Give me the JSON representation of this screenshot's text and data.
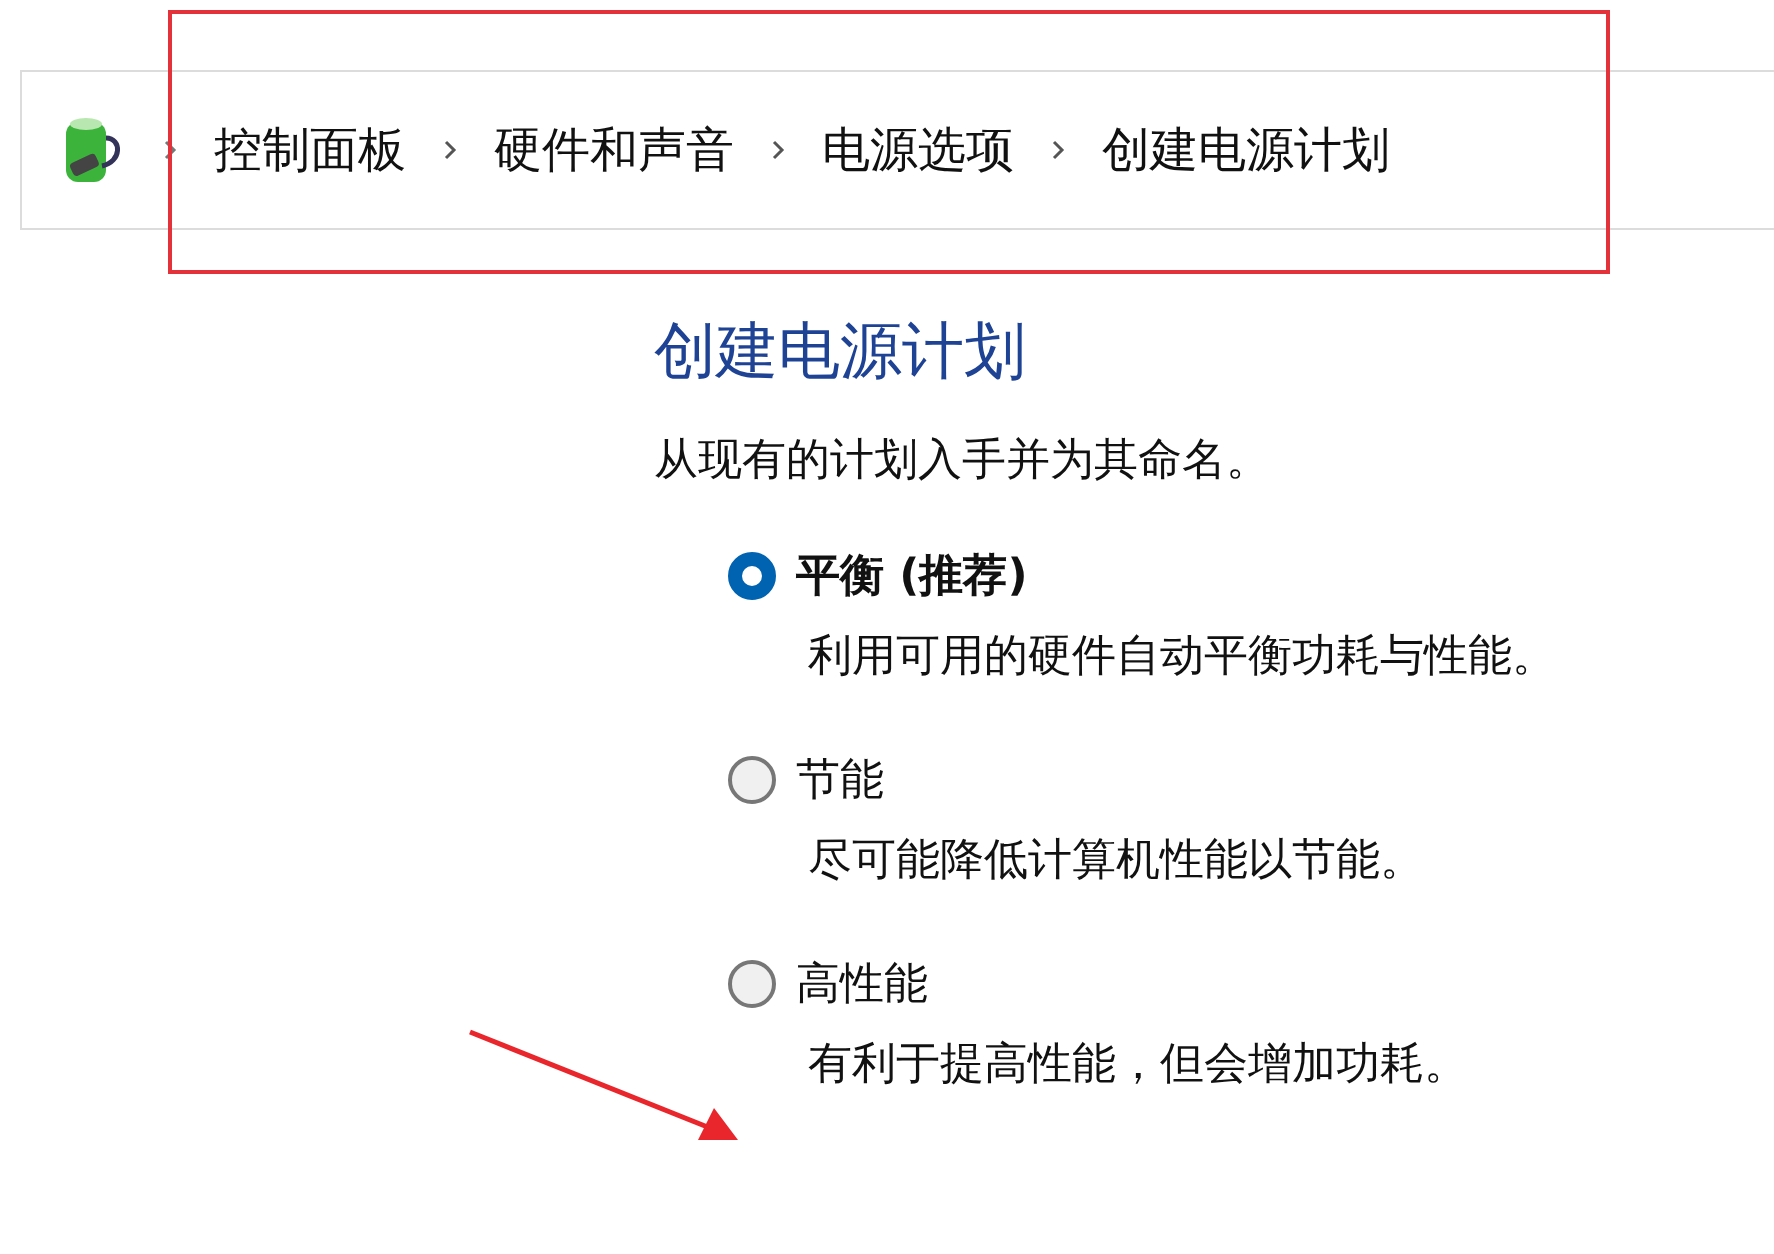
{
  "breadcrumb": [
    "控制面板",
    "硬件和声音",
    "电源选项",
    "创建电源计划"
  ],
  "title": "创建电源计划",
  "subtitle": "从现有的计划入手并为其命名。",
  "plans": [
    {
      "label": "平衡 (推荐)",
      "description": "利用可用的硬件自动平衡功耗与性能。",
      "selected": true
    },
    {
      "label": "节能",
      "description": "尽可能降低计算机性能以节能。",
      "selected": false
    },
    {
      "label": "高性能",
      "description": "有利于提高性能，但会增加功耗。",
      "selected": false
    }
  ]
}
